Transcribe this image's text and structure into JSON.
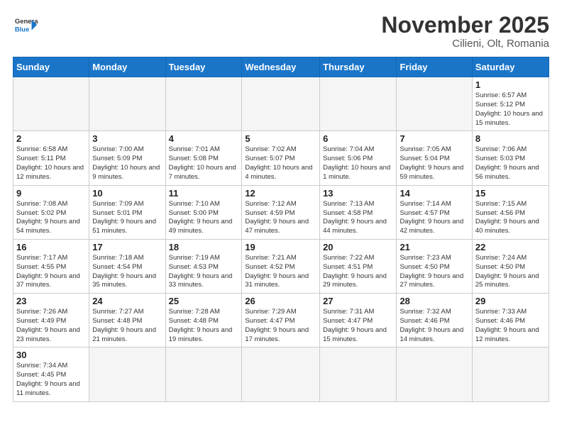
{
  "header": {
    "logo_general": "General",
    "logo_blue": "Blue",
    "month_title": "November 2025",
    "subtitle": "Cilieni, Olt, Romania"
  },
  "days_of_week": [
    "Sunday",
    "Monday",
    "Tuesday",
    "Wednesday",
    "Thursday",
    "Friday",
    "Saturday"
  ],
  "weeks": [
    [
      {
        "day": "",
        "info": ""
      },
      {
        "day": "",
        "info": ""
      },
      {
        "day": "",
        "info": ""
      },
      {
        "day": "",
        "info": ""
      },
      {
        "day": "",
        "info": ""
      },
      {
        "day": "",
        "info": ""
      },
      {
        "day": "1",
        "info": "Sunrise: 6:57 AM\nSunset: 5:12 PM\nDaylight: 10 hours\nand 15 minutes."
      }
    ],
    [
      {
        "day": "2",
        "info": "Sunrise: 6:58 AM\nSunset: 5:11 PM\nDaylight: 10 hours\nand 12 minutes."
      },
      {
        "day": "3",
        "info": "Sunrise: 7:00 AM\nSunset: 5:09 PM\nDaylight: 10 hours\nand 9 minutes."
      },
      {
        "day": "4",
        "info": "Sunrise: 7:01 AM\nSunset: 5:08 PM\nDaylight: 10 hours\nand 7 minutes."
      },
      {
        "day": "5",
        "info": "Sunrise: 7:02 AM\nSunset: 5:07 PM\nDaylight: 10 hours\nand 4 minutes."
      },
      {
        "day": "6",
        "info": "Sunrise: 7:04 AM\nSunset: 5:06 PM\nDaylight: 10 hours\nand 1 minute."
      },
      {
        "day": "7",
        "info": "Sunrise: 7:05 AM\nSunset: 5:04 PM\nDaylight: 9 hours\nand 59 minutes."
      },
      {
        "day": "8",
        "info": "Sunrise: 7:06 AM\nSunset: 5:03 PM\nDaylight: 9 hours\nand 56 minutes."
      }
    ],
    [
      {
        "day": "9",
        "info": "Sunrise: 7:08 AM\nSunset: 5:02 PM\nDaylight: 9 hours\nand 54 minutes."
      },
      {
        "day": "10",
        "info": "Sunrise: 7:09 AM\nSunset: 5:01 PM\nDaylight: 9 hours\nand 51 minutes."
      },
      {
        "day": "11",
        "info": "Sunrise: 7:10 AM\nSunset: 5:00 PM\nDaylight: 9 hours\nand 49 minutes."
      },
      {
        "day": "12",
        "info": "Sunrise: 7:12 AM\nSunset: 4:59 PM\nDaylight: 9 hours\nand 47 minutes."
      },
      {
        "day": "13",
        "info": "Sunrise: 7:13 AM\nSunset: 4:58 PM\nDaylight: 9 hours\nand 44 minutes."
      },
      {
        "day": "14",
        "info": "Sunrise: 7:14 AM\nSunset: 4:57 PM\nDaylight: 9 hours\nand 42 minutes."
      },
      {
        "day": "15",
        "info": "Sunrise: 7:15 AM\nSunset: 4:56 PM\nDaylight: 9 hours\nand 40 minutes."
      }
    ],
    [
      {
        "day": "16",
        "info": "Sunrise: 7:17 AM\nSunset: 4:55 PM\nDaylight: 9 hours\nand 37 minutes."
      },
      {
        "day": "17",
        "info": "Sunrise: 7:18 AM\nSunset: 4:54 PM\nDaylight: 9 hours\nand 35 minutes."
      },
      {
        "day": "18",
        "info": "Sunrise: 7:19 AM\nSunset: 4:53 PM\nDaylight: 9 hours\nand 33 minutes."
      },
      {
        "day": "19",
        "info": "Sunrise: 7:21 AM\nSunset: 4:52 PM\nDaylight: 9 hours\nand 31 minutes."
      },
      {
        "day": "20",
        "info": "Sunrise: 7:22 AM\nSunset: 4:51 PM\nDaylight: 9 hours\nand 29 minutes."
      },
      {
        "day": "21",
        "info": "Sunrise: 7:23 AM\nSunset: 4:50 PM\nDaylight: 9 hours\nand 27 minutes."
      },
      {
        "day": "22",
        "info": "Sunrise: 7:24 AM\nSunset: 4:50 PM\nDaylight: 9 hours\nand 25 minutes."
      }
    ],
    [
      {
        "day": "23",
        "info": "Sunrise: 7:26 AM\nSunset: 4:49 PM\nDaylight: 9 hours\nand 23 minutes."
      },
      {
        "day": "24",
        "info": "Sunrise: 7:27 AM\nSunset: 4:48 PM\nDaylight: 9 hours\nand 21 minutes."
      },
      {
        "day": "25",
        "info": "Sunrise: 7:28 AM\nSunset: 4:48 PM\nDaylight: 9 hours\nand 19 minutes."
      },
      {
        "day": "26",
        "info": "Sunrise: 7:29 AM\nSunset: 4:47 PM\nDaylight: 9 hours\nand 17 minutes."
      },
      {
        "day": "27",
        "info": "Sunrise: 7:31 AM\nSunset: 4:47 PM\nDaylight: 9 hours\nand 15 minutes."
      },
      {
        "day": "28",
        "info": "Sunrise: 7:32 AM\nSunset: 4:46 PM\nDaylight: 9 hours\nand 14 minutes."
      },
      {
        "day": "29",
        "info": "Sunrise: 7:33 AM\nSunset: 4:46 PM\nDaylight: 9 hours\nand 12 minutes."
      }
    ],
    [
      {
        "day": "30",
        "info": "Sunrise: 7:34 AM\nSunset: 4:45 PM\nDaylight: 9 hours\nand 11 minutes."
      },
      {
        "day": "",
        "info": ""
      },
      {
        "day": "",
        "info": ""
      },
      {
        "day": "",
        "info": ""
      },
      {
        "day": "",
        "info": ""
      },
      {
        "day": "",
        "info": ""
      },
      {
        "day": "",
        "info": ""
      }
    ]
  ]
}
